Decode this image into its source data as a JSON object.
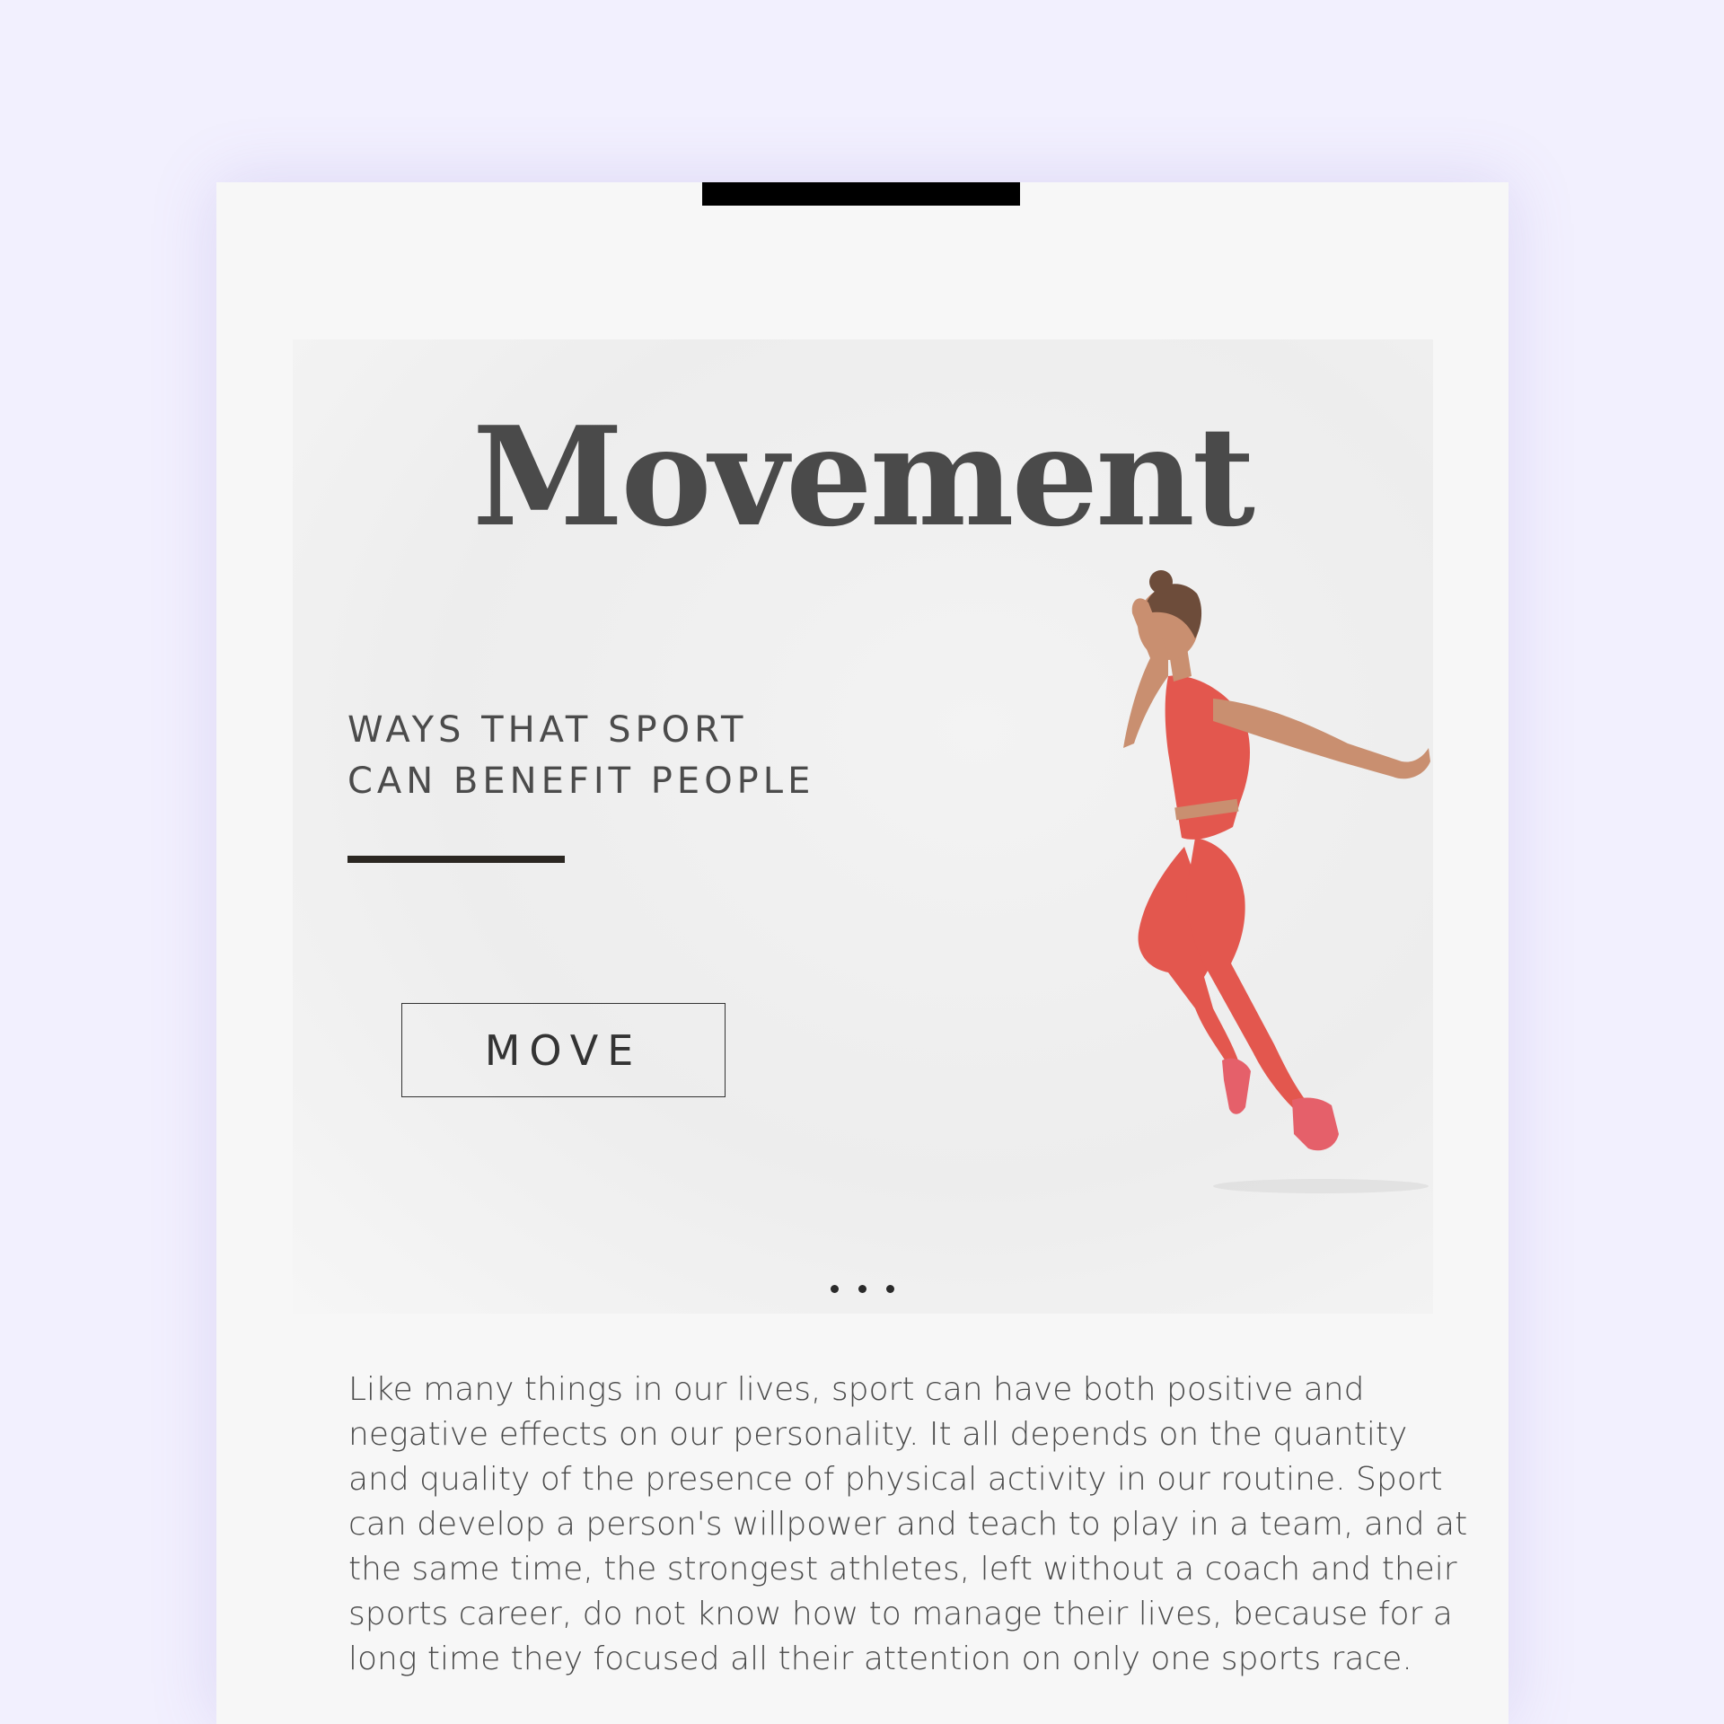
{
  "page": {
    "title": "Movement",
    "subtitle_lines": [
      "WAYS THAT SPORT",
      "CAN BENEFIT PEOPLE"
    ],
    "button_label": "MOVE",
    "body_lines": [
      "Like many things in our lives, sport can have both positive and",
      "negative effects on our personality. It all depends on the quantity",
      "and quality of the presence of physical activity in our routine. Sport",
      "can develop a person's willpower and teach to play in a team, and at",
      "the same time, the strongest athletes, left without a coach and their",
      "sports career, do not know how to manage their lives, because for a",
      "long time they focused all their attention on only one sports race."
    ]
  },
  "pagination": {
    "dot_count": 3
  },
  "colors": {
    "background": "#f2f0fe",
    "card": "#f7f7f7",
    "title": "#4a4a4a",
    "divider": "#2b2722",
    "outfit": "#e3574e",
    "skin": "#c98f70",
    "hair": "#6d4c3a"
  }
}
